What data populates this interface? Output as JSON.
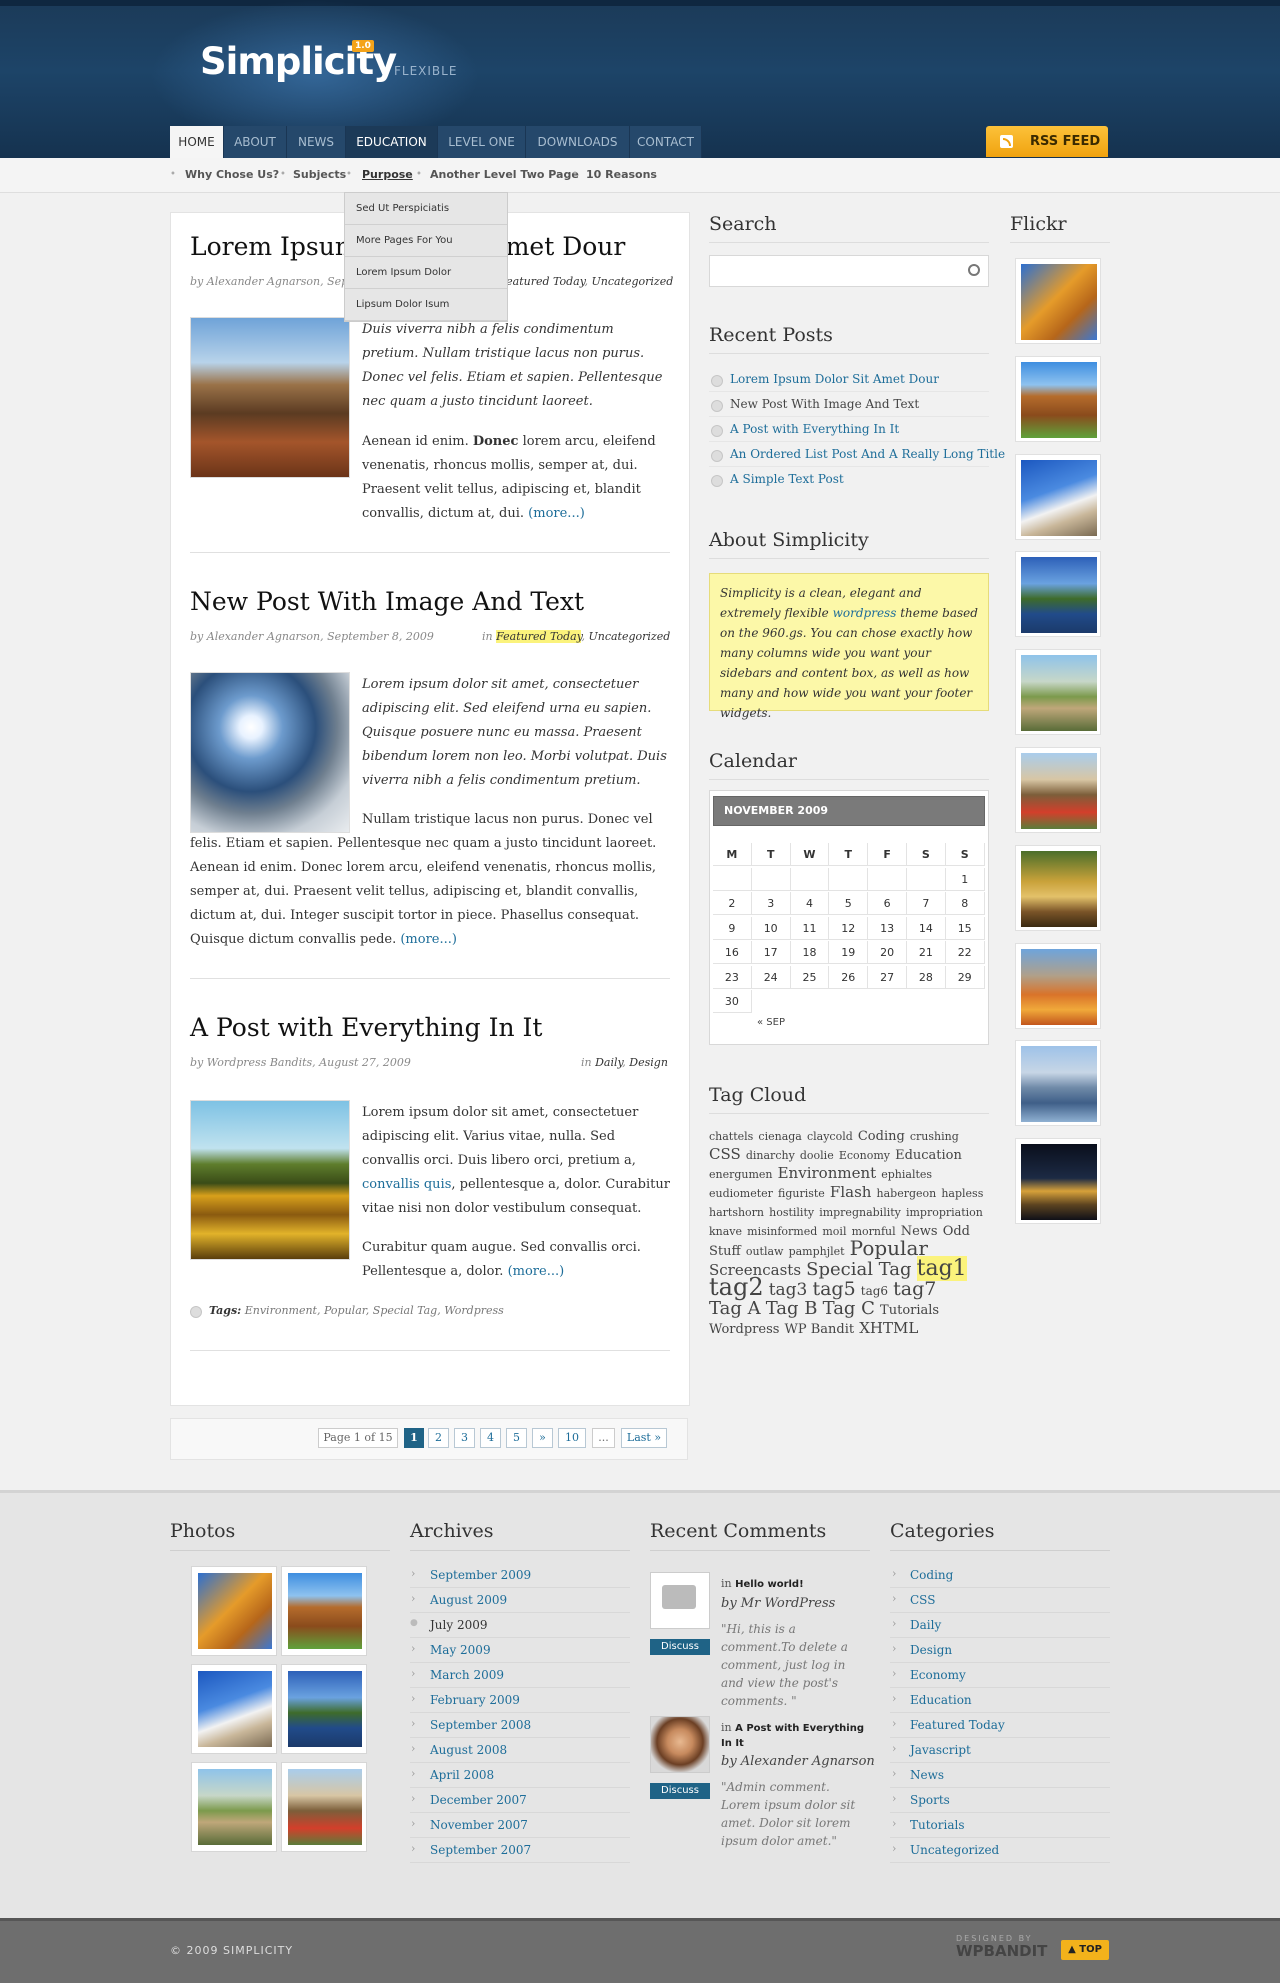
{
  "header": {
    "logo": "Simplicity",
    "badge": "1.0",
    "tagline": "FLEXIBLE",
    "rss_label": "RSS FEED"
  },
  "nav": [
    "HOME",
    "ABOUT",
    "NEWS",
    "EDUCATION",
    "LEVEL ONE",
    "DOWNLOADS",
    "CONTACT"
  ],
  "subnav": [
    "Why Chose Us?",
    "Subjects",
    "Purpose",
    "Another Level Two Page",
    "10 Reasons"
  ],
  "dropdown": [
    "Sed Ut Perspiciatis",
    "More Pages For You",
    "Lorem Ipsum Dolor",
    "Lipsum Dolor Isum"
  ],
  "posts": [
    {
      "title": "Lorem Ipsum Dolor Sit Amet Dour",
      "meta_author": "by Alexander Agnarson, Sep",
      "meta_in": "in",
      "cat1": "Featured Today",
      "cat2": "Uncategorized",
      "p1": "Duis viverra nibh a felis condimentum pretium. Nullam tristique lacus non purus. Donec vel felis. Etiam et sapien. Pellentesque nec quam a justo tincidunt laoreet.",
      "p2_a": "Aenean id enim.",
      "p2_b": "Donec",
      "p2_c": "lorem arcu, eleifend venenatis, rhoncus mollis, semper at, dui. Praesent velit tellus, adipiscing et, blandit convallis, dictum at, dui.",
      "more": "(more...)"
    },
    {
      "title": "New Post With Image And Text",
      "meta_author": "by Alexander Agnarson, September 8, 2009",
      "meta_in": "in",
      "cat1": "Featured Today",
      "cat2": "Uncategorized",
      "p1": "Lorem ipsum dolor sit amet, consectetuer adipiscing elit. Sed eleifend urna eu sapien. Quisque posuere nunc eu massa. Praesent bibendum lorem non leo. Morbi volutpat. Duis viverra nibh a felis condimentum pretium.",
      "p2": "Nullam tristique lacus non purus. Donec vel felis. Etiam et sapien. Pellentesque nec quam a justo tincidunt laoreet. Aenean id enim. Donec lorem arcu, eleifend venenatis, rhoncus mollis, semper at, dui. Praesent velit tellus, adipiscing et, blandit convallis, dictum at, dui. Integer suscipit tortor in piece. Phasellus consequat. Quisque dictum convallis pede.",
      "more": "(more...)"
    },
    {
      "title": "A Post with Everything In It",
      "meta_author": "by Wordpress Bandits, August 27, 2009",
      "meta_in": "in",
      "cat1": "Daily",
      "cat2": "Design",
      "p1_a": "Lorem ipsum dolor sit amet, consectetuer adipiscing elit. Varius vitae, nulla. Sed convallis orci. Duis libero orci, pretium a,",
      "p1_link": "convallis quis",
      "p1_b": ", pellentesque a, dolor. Curabitur vitae nisi non dolor vestibulum consequat.",
      "p2": "Curabitur quam augue. Sed convallis orci. Pellentesque a, dolor.",
      "more": "(more...)",
      "tags_label": "Tags:",
      "tags": "Environment, Popular, Special Tag, Wordpress"
    }
  ],
  "pagination": {
    "info": "Page 1 of 15",
    "pages": [
      "1",
      "2",
      "3",
      "4",
      "5",
      "»",
      "10",
      "...",
      "Last »"
    ]
  },
  "sidebar": {
    "search_title": "Search",
    "recent_title": "Recent Posts",
    "recent": [
      "Lorem Ipsum Dolor Sit Amet Dour",
      "New Post With Image And Text",
      "A Post with Everything In It",
      "An Ordered List Post And A Really Long Title",
      "A Simple Text Post"
    ],
    "about_title": "About Simplicity",
    "about_a": "Simplicity is a clean, elegant and extremely flexible",
    "about_link": "wordpress",
    "about_b": "theme based on the 960.gs. You can chose exactly how many columns wide you want your sidebars and content box, as well as how many and how wide you want your footer widgets.",
    "calendar_title": "Calendar",
    "calendar_month": "NOVEMBER 2009",
    "calendar_days": [
      "M",
      "T",
      "W",
      "T",
      "F",
      "S",
      "S"
    ],
    "calendar_prev": "« SEP",
    "tag_title": "Tag Cloud",
    "flickr_title": "Flickr"
  },
  "tags": [
    {
      "t": "chattels",
      "s": 11
    },
    {
      "t": "cienaga",
      "s": 11
    },
    {
      "t": "claycold",
      "s": 11
    },
    {
      "t": "Coding",
      "s": 13
    },
    {
      "t": "crushing",
      "s": 11
    },
    {
      "t": "CSS",
      "s": 15
    },
    {
      "t": "dinarchy",
      "s": 11
    },
    {
      "t": "doolie",
      "s": 11
    },
    {
      "t": "Economy",
      "s": 11
    },
    {
      "t": "Education",
      "s": 13
    },
    {
      "t": "energumen",
      "s": 11
    },
    {
      "t": "Environment",
      "s": 15
    },
    {
      "t": "ephialtes",
      "s": 11
    },
    {
      "t": "eudiometer",
      "s": 11
    },
    {
      "t": "figuriste",
      "s": 11
    },
    {
      "t": "Flash",
      "s": 15
    },
    {
      "t": "habergeon",
      "s": 11
    },
    {
      "t": "hapless",
      "s": 11
    },
    {
      "t": "hartshorn",
      "s": 11
    },
    {
      "t": "hostility",
      "s": 11
    },
    {
      "t": "impregnability",
      "s": 11
    },
    {
      "t": "impropriation",
      "s": 11
    },
    {
      "t": "knave",
      "s": 11
    },
    {
      "t": "misinformed",
      "s": 11
    },
    {
      "t": "moil",
      "s": 11
    },
    {
      "t": "mornful",
      "s": 11
    },
    {
      "t": "News",
      "s": 13
    },
    {
      "t": "Odd",
      "s": 13
    },
    {
      "t": "Stuff",
      "s": 13
    },
    {
      "t": "outlaw",
      "s": 11
    },
    {
      "t": "pamphjlet",
      "s": 11
    },
    {
      "t": "Popular",
      "s": 20
    },
    {
      "t": "Screencasts",
      "s": 15
    },
    {
      "t": "Special Tag",
      "s": 18
    },
    {
      "t": "tag1",
      "s": 22
    },
    {
      "t": "tag2",
      "s": 24
    },
    {
      "t": "tag3",
      "s": 17
    },
    {
      "t": "tag5",
      "s": 19
    },
    {
      "t": "tag6",
      "s": 12
    },
    {
      "t": "tag7",
      "s": 19
    },
    {
      "t": "Tag A",
      "s": 18
    },
    {
      "t": "Tag B",
      "s": 18
    },
    {
      "t": "Tag C",
      "s": 18
    },
    {
      "t": "Tutorials",
      "s": 13
    },
    {
      "t": "Wordpress",
      "s": 13
    },
    {
      "t": "WP Bandit",
      "s": 13
    },
    {
      "t": "XHTML",
      "s": 15
    }
  ],
  "footer": {
    "photos_title": "Photos",
    "archives_title": "Archives",
    "archives": [
      "September 2009",
      "August 2009",
      "July 2009",
      "May 2009",
      "March 2009",
      "February 2009",
      "September 2008",
      "August 2008",
      "April 2008",
      "December 2007",
      "November 2007",
      "September 2007"
    ],
    "comments_title": "Recent Comments",
    "comments": [
      {
        "in": "in",
        "post": "Hello world!",
        "by": "by Mr WordPress",
        "text": "\"Hi, this is a comment.To delete a comment, just log in and view the post's comments. \"",
        "discuss": "Discuss"
      },
      {
        "in": "in",
        "post": "A Post with Everything In It",
        "by": "by Alexander Agnarson",
        "text": "\"Admin comment. Lorem ipsum dolor sit amet. Dolor sit lorem ipsum dolor amet.\"",
        "discuss": "Discuss"
      }
    ],
    "categories_title": "Categories",
    "categories": [
      "Coding",
      "CSS",
      "Daily",
      "Design",
      "Economy",
      "Education",
      "Featured Today",
      "Javascript",
      "News",
      "Sports",
      "Tutorials",
      "Uncategorized"
    ],
    "copyright": "© 2009 SIMPLICITY",
    "designed_by": "DESIGNED BY",
    "designer": "WPBANDIT",
    "top": "▲ TOP"
  }
}
